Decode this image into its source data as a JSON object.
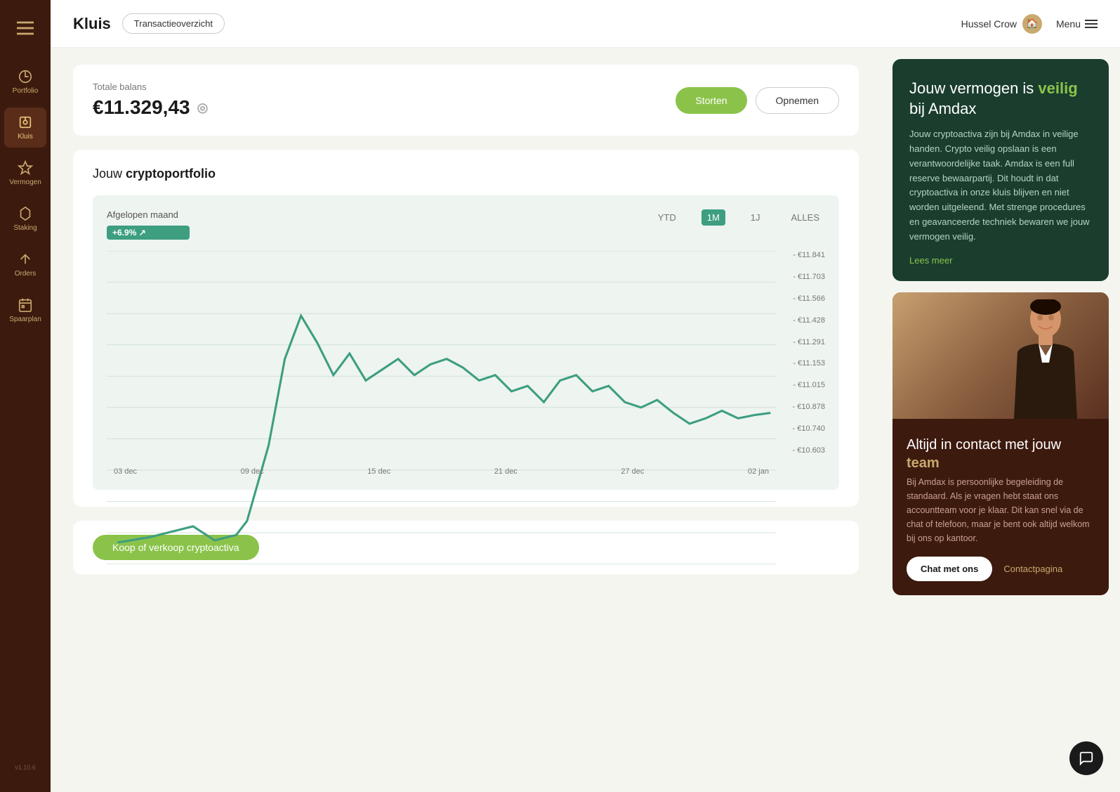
{
  "sidebar": {
    "logo_symbol": "≡",
    "items": [
      {
        "id": "portfolio",
        "label": "Portfolio",
        "icon": "portfolio"
      },
      {
        "id": "kluis",
        "label": "Kluis",
        "icon": "kluis",
        "active": true
      },
      {
        "id": "vermogen",
        "label": "Vermogen",
        "icon": "vermogen"
      },
      {
        "id": "staking",
        "label": "Staking",
        "icon": "staking"
      },
      {
        "id": "orders",
        "label": "Orders",
        "icon": "orders"
      },
      {
        "id": "spaarplan",
        "label": "Spaarplan",
        "icon": "spaarplan"
      }
    ],
    "version": "v1.10.6"
  },
  "navbar": {
    "title": "Kluis",
    "transaction_btn": "Transactieoverzicht",
    "user_name": "Hussel Crow",
    "menu_label": "Menu"
  },
  "balance": {
    "label": "Totale balans",
    "amount": "€11.329,43",
    "btn_storten": "Storten",
    "btn_opnemen": "Opnemen"
  },
  "portfolio": {
    "title_pre": "Jouw ",
    "title_bold": "cryptoportfolio",
    "chart": {
      "period_label": "Afgelopen maand",
      "badge": "+6.9% ↗",
      "tabs": [
        "YTD",
        "1M",
        "1J",
        "ALLES"
      ],
      "active_tab": "1M",
      "y_labels": [
        "€11.841",
        "€11.703",
        "€11.566",
        "€11.428",
        "€11.291",
        "€11.153",
        "€11.015",
        "€10.878",
        "€10.740",
        "€10.603"
      ],
      "x_labels": [
        "03 dec",
        "09 dec",
        "15 dec",
        "21 dec",
        "27 dec",
        "02 jan"
      ]
    }
  },
  "buy_section": {
    "btn_label": "Koop of verkoop cryptoactiva"
  },
  "right_panel": {
    "security_card": {
      "title_pre": "Jouw vermogen is ",
      "title_highlight": "veilig",
      "title_post": " bij Amdax",
      "body": "Jouw cryptoactiva zijn bij Amdax in veilige handen. Crypto veilig opslaan is een verantwoordelijke taak. Amdax is een full reserve bewaarpartij. Dit houdt in dat cryptoactiva in onze kluis blijven en niet worden uitgeleend. Met strenge procedures en geavanceerde techniek bewaren we jouw vermogen veilig.",
      "lees_meer": "Lees meer"
    },
    "contact_card": {
      "title_pre": "Altijd in contact met jouw ",
      "title_highlight": "team",
      "body": "Bij Amdax is persoonlijke begeleiding de standaard. Als je vragen hebt staat ons accountteam voor je klaar. Dit kan snel via de chat of telefoon, maar je bent ook altijd welkom bij ons op kantoor.",
      "btn_chat": "Chat met ons",
      "btn_contact": "Contactpagina"
    }
  },
  "version": "v1.10.6"
}
